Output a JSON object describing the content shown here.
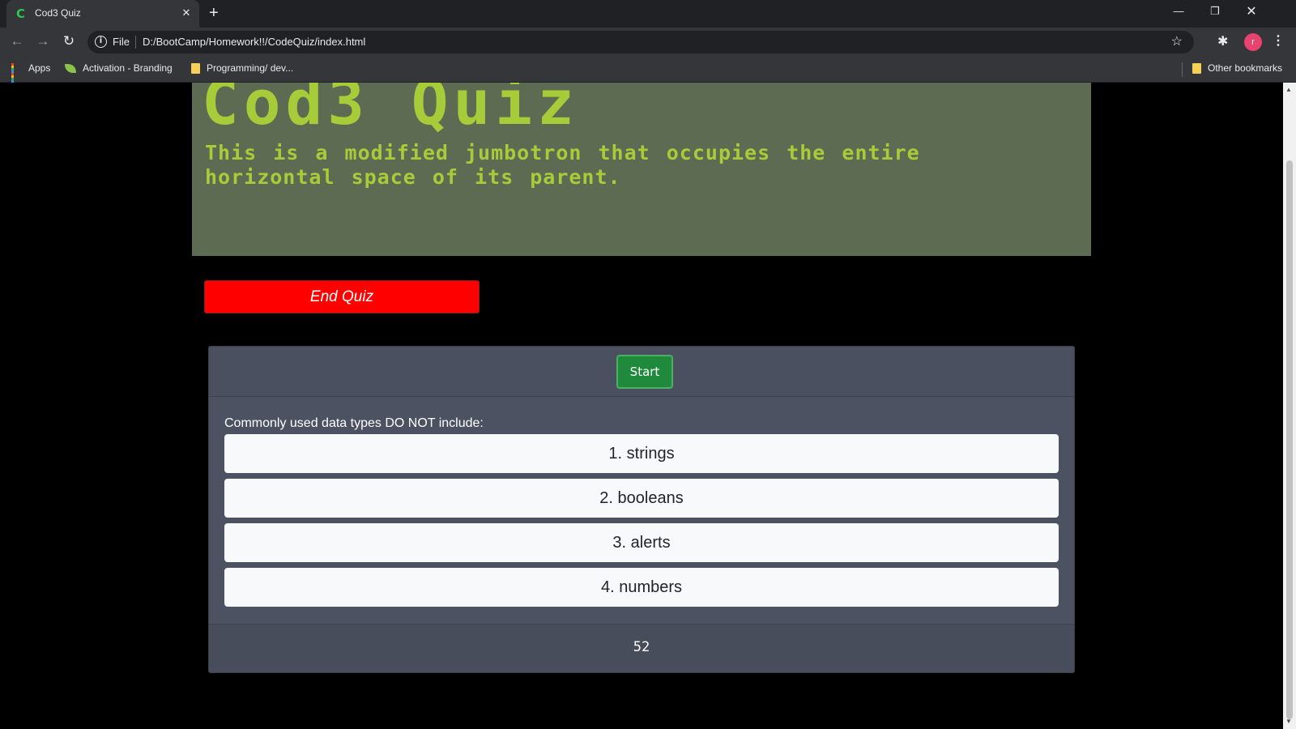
{
  "browser": {
    "tab_title": "Cod3 Quiz",
    "tab_favicon": "C",
    "url_scheme": "File",
    "url": "D:/BootCamp/Homework!!/CodeQuiz/index.html",
    "avatar_initial": "r",
    "bookmarks": [
      {
        "label": "Apps",
        "icon": "apps-grid-icon"
      },
      {
        "label": "Activation - Branding",
        "icon": "leaf-icon"
      },
      {
        "label": "Programming/ dev...",
        "icon": "folder-icon"
      }
    ],
    "other_bookmarks": "Other bookmarks"
  },
  "page": {
    "jumbotron": {
      "title": "Cod3 Quiz",
      "lead": "This is a modified jumbotron that occupies the entire horizontal space of its parent."
    },
    "end_button": "End Quiz",
    "start_button": "Start",
    "question": "Commonly used data types DO NOT include:",
    "answers": [
      "1. strings",
      "2. booleans",
      "3. alerts",
      "4. numbers"
    ],
    "timer": "52"
  },
  "colors": {
    "jumbotron_bg": "#5c6b51",
    "jumbotron_text": "#a7cc3a",
    "end_button_bg": "#ff0000",
    "start_button_bg": "#1f8a3c",
    "card_bg": "#4c5261"
  }
}
